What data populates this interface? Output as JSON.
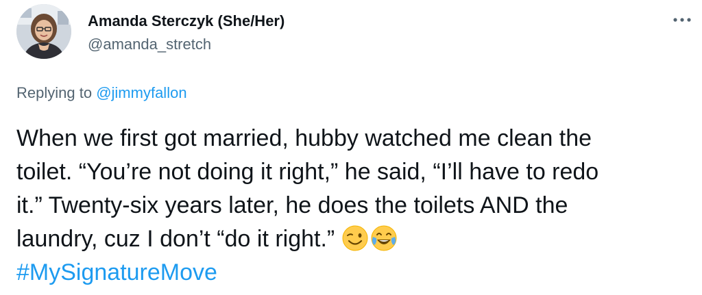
{
  "author": {
    "display_name": "Amanda Sterczyk (She/Her)",
    "handle": "@amanda_stretch"
  },
  "reply_context": {
    "prefix": "Replying to",
    "mention": "@jimmyfallon"
  },
  "tweet": {
    "lines": [
      "When we first got married, hubby watched me clean the",
      "toilet. “You’re not doing it right,” he said, “I’ll have to redo",
      "it.” Twenty-six years later, he does the toilets AND the",
      "laundry, cuz I don’t “do it right.”"
    ],
    "emojis": [
      "winking-face-emoji",
      "face-with-tears-of-joy-emoji"
    ],
    "hashtag": "#MySignatureMove"
  },
  "colors": {
    "link": "#1d9bf0",
    "secondary_text": "#536471",
    "primary_text": "#0f1419"
  },
  "icons": {
    "more": "more-options-icon"
  }
}
